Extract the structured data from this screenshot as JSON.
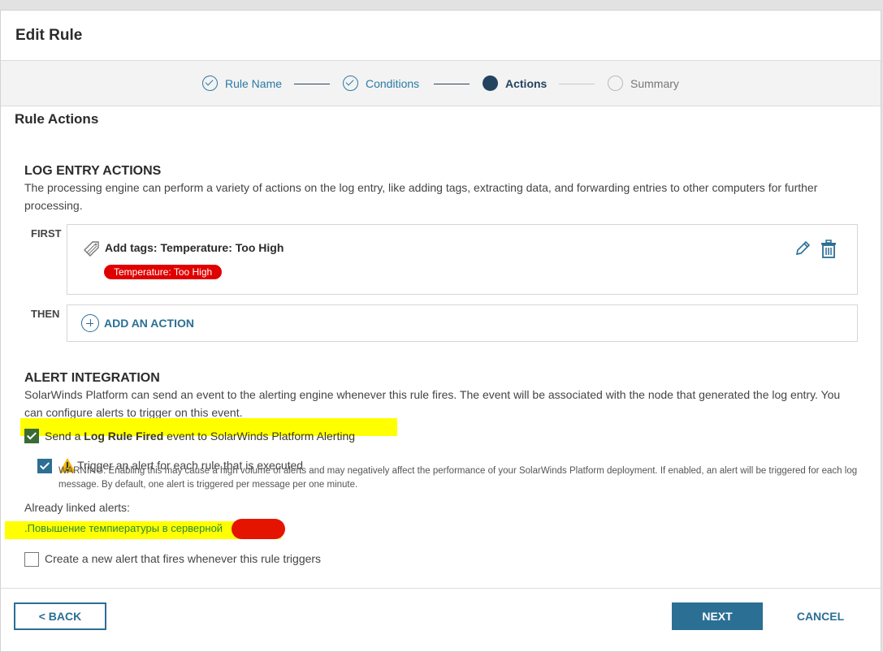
{
  "dialog": {
    "title": "Edit Rule"
  },
  "stepper": {
    "steps": [
      {
        "label": "Rule Name",
        "state": "done"
      },
      {
        "label": "Conditions",
        "state": "done"
      },
      {
        "label": "Actions",
        "state": "active"
      },
      {
        "label": "Summary",
        "state": "todo"
      }
    ]
  },
  "section": {
    "title": "Rule Actions"
  },
  "log_entry": {
    "heading": "LOG ENTRY ACTIONS",
    "description": "The processing engine can perform a variety of actions on the log entry, like adding tags, extracting data, and forwarding entries to other computers for further processing.",
    "first_label": "FIRST",
    "then_label": "THEN",
    "action_title": "Add tags: Temperature: Too High",
    "tag": "Temperature: Too High",
    "add_action": "ADD AN ACTION"
  },
  "alert": {
    "heading": "ALERT INTEGRATION",
    "description": "SolarWinds Platform can send an event to the alerting engine whenever this rule fires. The event will be associated with the node that generated the log entry. You can configure alerts to trigger on this event.",
    "send_pre": "Send a ",
    "send_bold": "Log Rule Fired",
    "send_post": " event to SolarWinds Platform Alerting",
    "send_checked": true,
    "trigger_label": "Trigger an alert for each rule that is executed",
    "trigger_checked": true,
    "warning": "WARNING: Enabling this may cause a high volume of alerts and may negatively affect the performance of your SolarWinds Platform deployment. If enabled, an alert will be triggered for each log message. By default, one alert is triggered per message per one minute.",
    "linked_label": "Already linked alerts:",
    "linked_alert": ".Повышение темпиературы в серверной",
    "new_alert_label": "Create a new alert that fires whenever this rule triggers",
    "new_alert_checked": false
  },
  "footer": {
    "back": "< BACK",
    "next": "NEXT",
    "cancel": "CANCEL"
  },
  "colors": {
    "accent": "#2b6f94",
    "active_step": "#24435f",
    "tag": "#e10000",
    "highlight": "#ffff00"
  }
}
